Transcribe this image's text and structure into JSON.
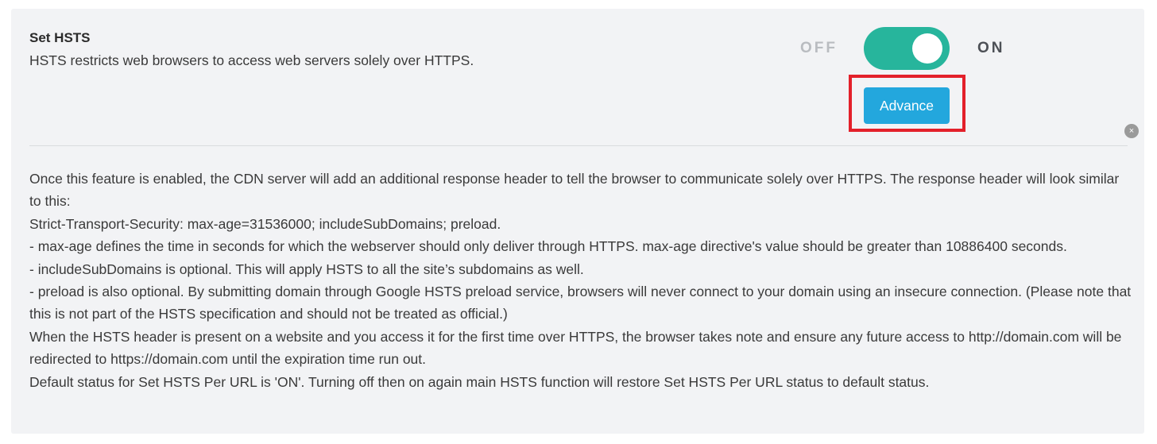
{
  "setting": {
    "title": "Set HSTS",
    "subtitle": "HSTS restricts web browsers to access web servers solely over HTTPS."
  },
  "toggle": {
    "off_label": "OFF",
    "on_label": "ON",
    "state": "on",
    "color_on": "#27b59c"
  },
  "advance_button": {
    "label": "Advance",
    "color": "#23a7dd"
  },
  "close_icon": {
    "glyph": "×"
  },
  "description": {
    "lines": [
      "Once this feature is enabled, the CDN server will add an additional response header to tell the browser to communicate solely over HTTPS. The response header will look similar to this:",
      "Strict-Transport-Security: max-age=31536000; includeSubDomains; preload.",
      "- max-age defines the time in seconds for which the webserver should only deliver through HTTPS. max-age directive's value should be greater than 10886400 seconds.",
      "- includeSubDomains is optional. This will apply HSTS to all the site’s subdomains as well.",
      "- preload is also optional. By submitting domain through Google HSTS preload service, browsers will never connect to your domain using an insecure connection. (Please note that this is not part of the HSTS specification and should not be treated as official.)",
      "When the HSTS header is present on a website and you access it for the first time over HTTPS, the browser takes note and ensure any future access to http://domain.com will be redirected to https://domain.com until the expiration time run out.",
      "Default status for Set HSTS Per URL is 'ON'. Turning off then on again main HSTS function will restore Set HSTS Per URL status to default status."
    ]
  },
  "colors": {
    "panel_bg": "#f2f3f5",
    "highlight_border": "#e3202a"
  }
}
